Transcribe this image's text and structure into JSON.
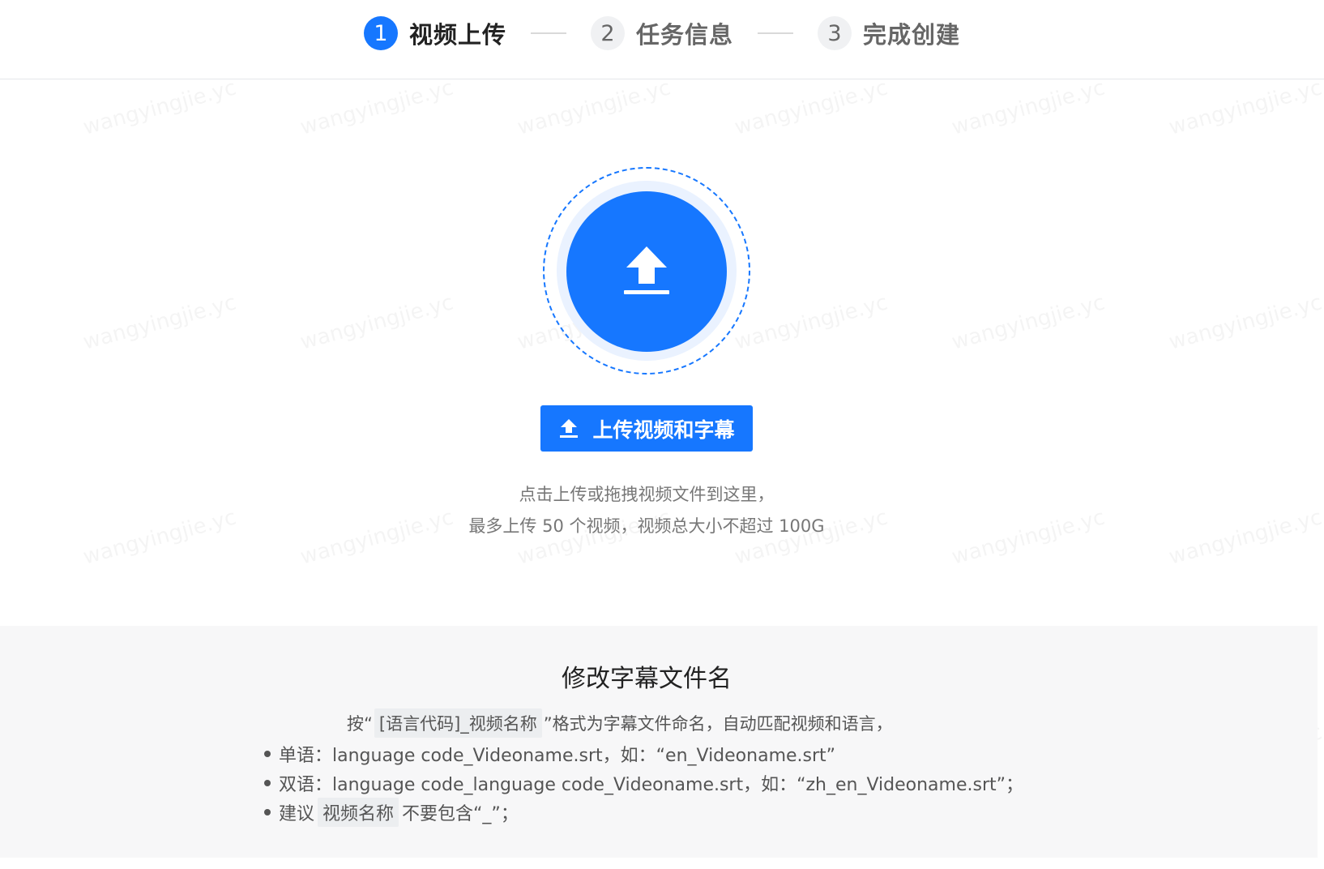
{
  "steps": [
    {
      "number": "1",
      "label": "视频上传",
      "active": true
    },
    {
      "number": "2",
      "label": "任务信息",
      "active": false
    },
    {
      "number": "3",
      "label": "完成创建",
      "active": false
    }
  ],
  "watermark": "wangyingjie.yc",
  "upload": {
    "icon": "upload-arrow-icon",
    "button_label": "上传视频和字幕",
    "hint_line1": "点击上传或拖拽视频文件到这里，",
    "hint_line2": "最多上传 50 个视频，视频总大小不超过 100G"
  },
  "rename": {
    "title": "修改字幕文件名",
    "desc_prefix": "按“",
    "desc_code": "[语言代码]_视频名称",
    "desc_suffix": "”格式为字幕文件命名，自动匹配视频和语言，",
    "rule1": "单语：language code_Videoname.srt，如：“en_Videoname.srt”",
    "rule2": "双语：language code_language code_Videoname.srt，如：“zh_en_Videoname.srt”；",
    "rule3_prefix": "建议",
    "rule3_code": "视频名称",
    "rule3_suffix": "不要包含“_”；"
  },
  "colors": {
    "primary": "#1677ff",
    "section_bg": "#f7f7f8"
  }
}
